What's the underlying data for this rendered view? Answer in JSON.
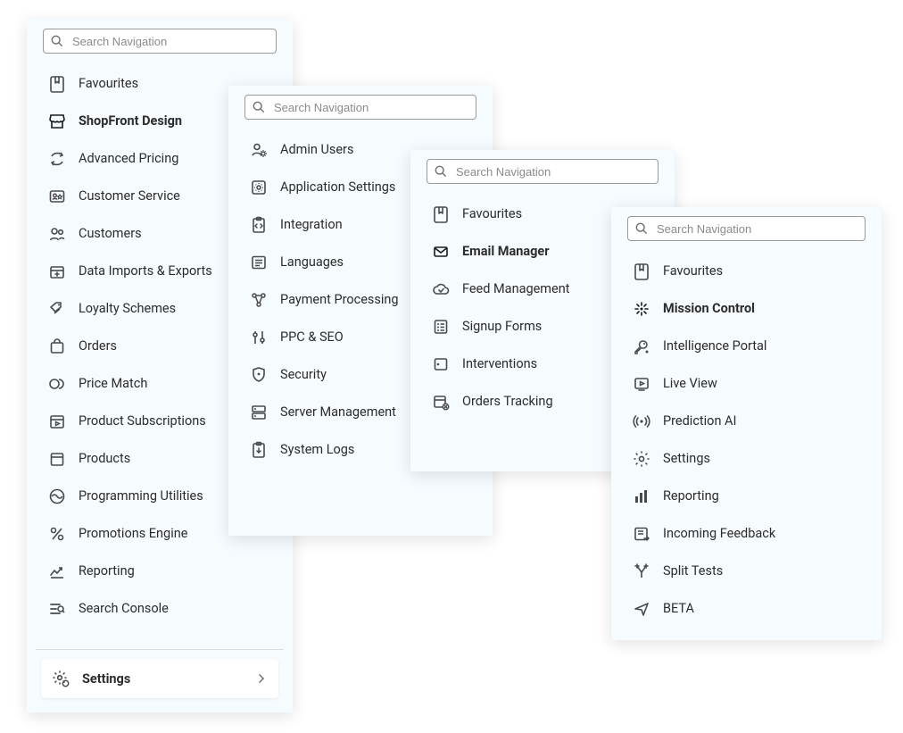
{
  "search": {
    "placeholder": "Search Navigation"
  },
  "panel1": {
    "items": [
      {
        "label": "Favourites",
        "icon": "bookmark-badge"
      },
      {
        "label": "ShopFront Design",
        "icon": "storefront",
        "active": true
      },
      {
        "label": "Advanced Pricing",
        "icon": "refresh-money"
      },
      {
        "label": "Customer Service",
        "icon": "id-star"
      },
      {
        "label": "Customers",
        "icon": "people"
      },
      {
        "label": "Data Imports & Exports",
        "icon": "box-plus"
      },
      {
        "label": "Loyalty Schemes",
        "icon": "tags"
      },
      {
        "label": "Orders",
        "icon": "cart"
      },
      {
        "label": "Price Match",
        "icon": "two-circles"
      },
      {
        "label": "Product Subscriptions",
        "icon": "calendar-play"
      },
      {
        "label": "Products",
        "icon": "box"
      },
      {
        "label": "Programming Utilities",
        "icon": "wave"
      },
      {
        "label": "Promotions Engine",
        "icon": "percent"
      },
      {
        "label": "Reporting",
        "icon": "trend"
      },
      {
        "label": "Search Console",
        "icon": "search-list"
      }
    ],
    "footer": {
      "label": "Settings",
      "icon": "gear-badge"
    }
  },
  "panel2": {
    "items": [
      {
        "label": "Admin Users",
        "icon": "user-gear"
      },
      {
        "label": "Application Settings",
        "icon": "app-gear"
      },
      {
        "label": "Integration",
        "icon": "clipboard-brackets"
      },
      {
        "label": "Languages",
        "icon": "text-panel"
      },
      {
        "label": "Payment Processing",
        "icon": "nodes"
      },
      {
        "label": "PPC & SEO",
        "icon": "sliders"
      },
      {
        "label": "Security",
        "icon": "shield"
      },
      {
        "label": "Server Management",
        "icon": "stack"
      },
      {
        "label": "System Logs",
        "icon": "clipboard-down"
      }
    ]
  },
  "panel3": {
    "items": [
      {
        "label": "Favourites",
        "icon": "bookmark-badge"
      },
      {
        "label": "Email Manager",
        "icon": "envelope",
        "active": true
      },
      {
        "label": "Feed Management",
        "icon": "cloud-check"
      },
      {
        "label": "Signup Forms",
        "icon": "form"
      },
      {
        "label": "Interventions",
        "icon": "square-dot"
      },
      {
        "label": "Orders Tracking",
        "icon": "calendar-x"
      }
    ]
  },
  "panel4": {
    "items": [
      {
        "label": "Favourites",
        "icon": "bookmark-badge"
      },
      {
        "label": "Mission Control",
        "icon": "spark",
        "active": true
      },
      {
        "label": "Intelligence Portal",
        "icon": "key-dot"
      },
      {
        "label": "Live View",
        "icon": "screen-play"
      },
      {
        "label": "Prediction AI",
        "icon": "broadcast"
      },
      {
        "label": "Settings",
        "icon": "gear"
      },
      {
        "label": "Reporting",
        "icon": "bars"
      },
      {
        "label": "Incoming Feedback",
        "icon": "note-arrow"
      },
      {
        "label": "Split Tests",
        "icon": "split"
      },
      {
        "label": "BETA",
        "icon": "send"
      }
    ]
  }
}
